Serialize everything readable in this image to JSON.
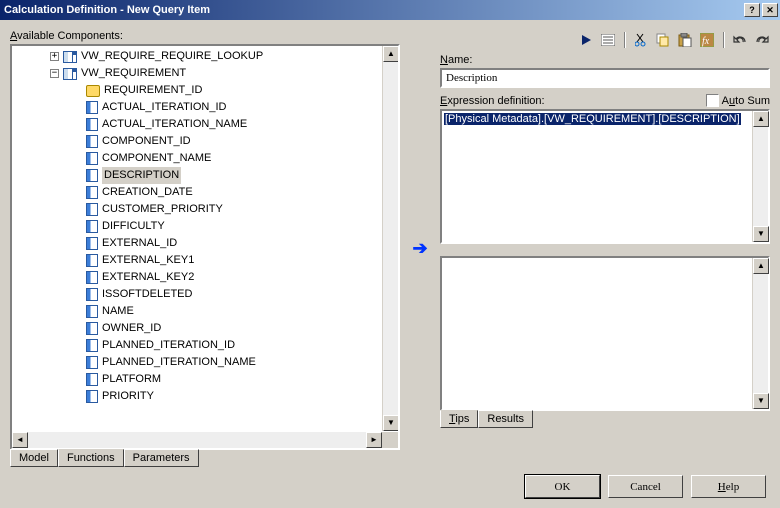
{
  "window": {
    "title": "Calculation Definition - New Query Item"
  },
  "left": {
    "label": "Available Components:",
    "tree": {
      "root1": {
        "label": "VW_REQUIRE_REQUIRE_LOOKUP",
        "expanded": false
      },
      "root2": {
        "label": "VW_REQUIREMENT",
        "expanded": true
      },
      "columns": [
        "REQUIREMENT_ID",
        "ACTUAL_ITERATION_ID",
        "ACTUAL_ITERATION_NAME",
        "COMPONENT_ID",
        "COMPONENT_NAME",
        "DESCRIPTION",
        "CREATION_DATE",
        "CUSTOMER_PRIORITY",
        "DIFFICULTY",
        "EXTERNAL_ID",
        "EXTERNAL_KEY1",
        "EXTERNAL_KEY2",
        "ISSOFTDELETED",
        "NAME",
        "OWNER_ID",
        "PLANNED_ITERATION_ID",
        "PLANNED_ITERATION_NAME",
        "PLATFORM",
        "PRIORITY"
      ],
      "selected_index": 5
    },
    "tabs": [
      "Model",
      "Functions",
      "Parameters"
    ]
  },
  "right": {
    "name_label": "Name:",
    "name_value": "Description",
    "expr_label": "Expression definition:",
    "autosum_label": "Auto Sum",
    "expr_value": "[Physical Metadata].[VW_REQUIREMENT].[DESCRIPTION]",
    "tabs": [
      "Tips",
      "Results"
    ]
  },
  "buttons": {
    "ok": "OK",
    "cancel": "Cancel",
    "help": "Help"
  },
  "toolbar_icons": [
    "play",
    "list",
    "cut",
    "copy",
    "paste",
    "fx",
    "undo",
    "redo"
  ]
}
